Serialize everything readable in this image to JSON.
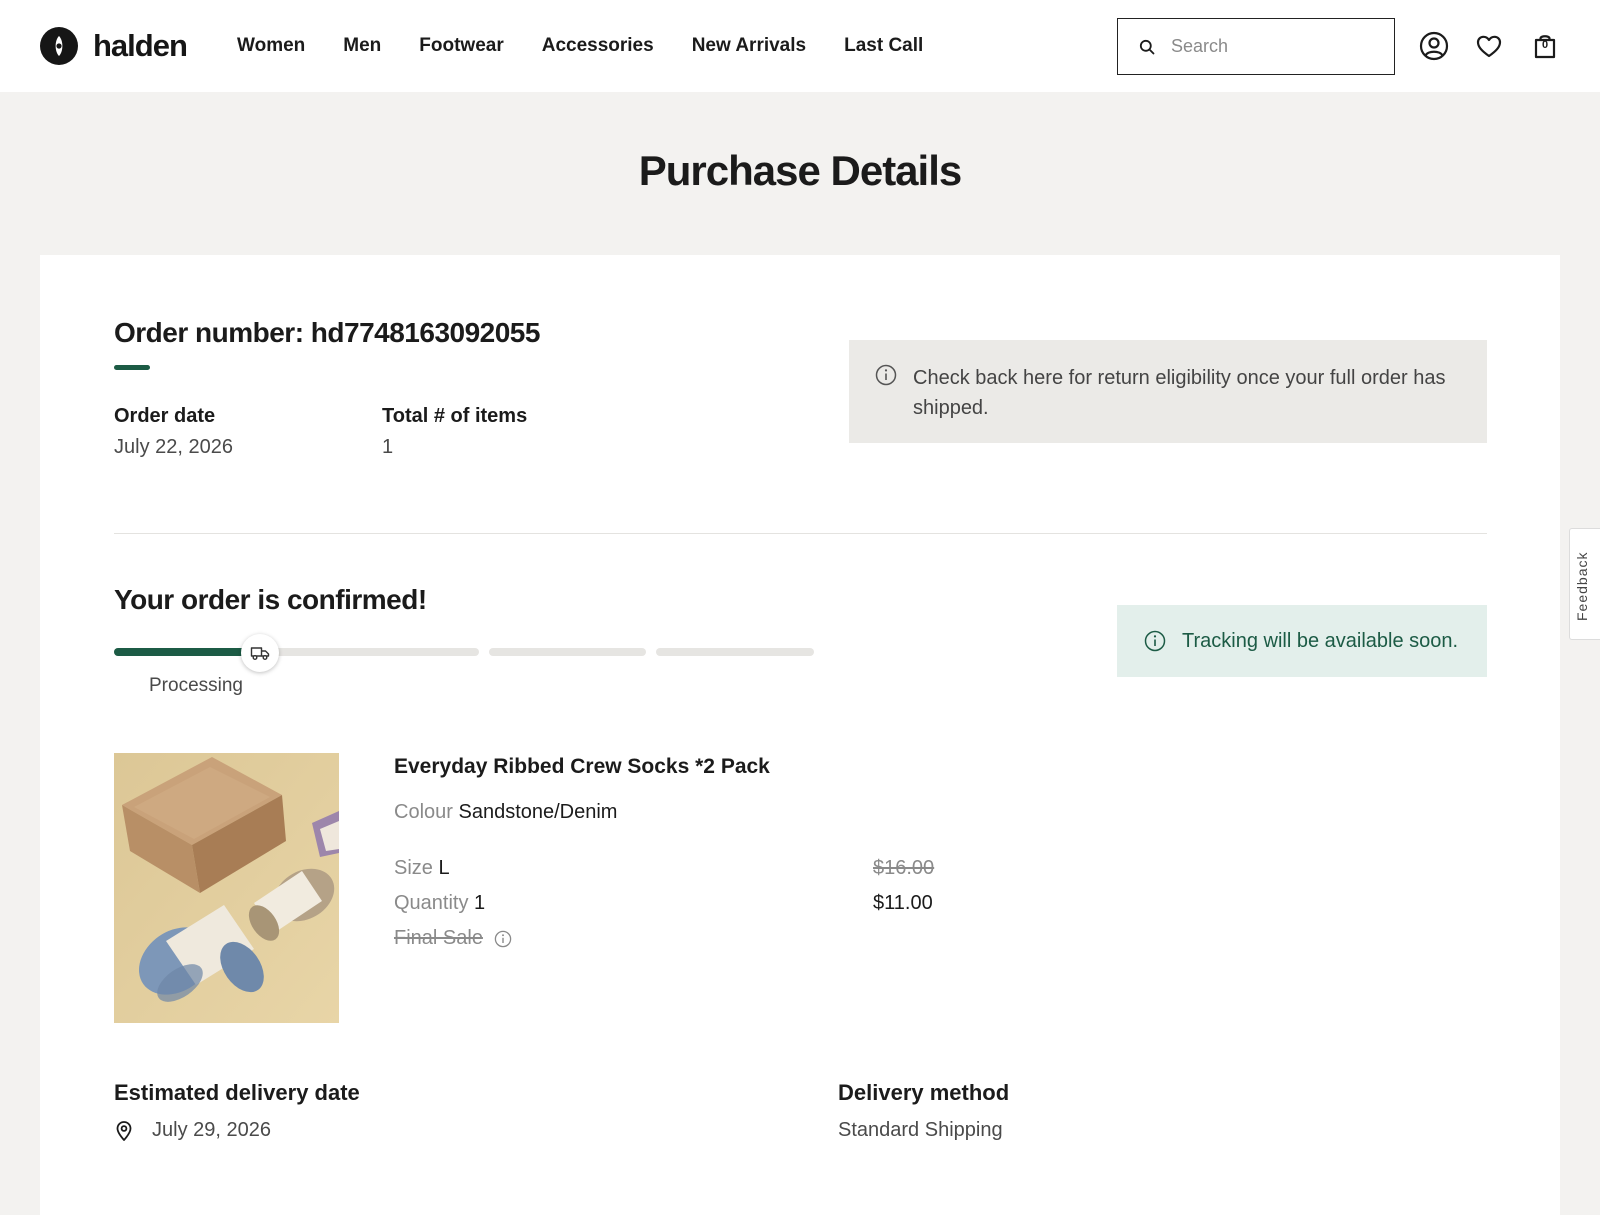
{
  "brand": {
    "name": "halden",
    "accent_color": "#1c5b45"
  },
  "nav": {
    "items": [
      "Women",
      "Men",
      "Footwear",
      "Accessories",
      "New Arrivals",
      "Last Call"
    ]
  },
  "search": {
    "placeholder": "Search",
    "value": ""
  },
  "header_icons": {
    "account": "account-icon",
    "wishlist": "heart-icon",
    "bag": "shopping-bag-icon",
    "bag_count": "0"
  },
  "page": {
    "title": "Purchase Details"
  },
  "order": {
    "number_label": "Order number: hd7748163092055",
    "date_label": "Order date",
    "date_value": "July 22, 2026",
    "items_label": "Total # of items",
    "items_value": "1",
    "return_notice": "Check back here for return eligibility once your full order has shipped."
  },
  "status": {
    "title": "Your order is confirmed!",
    "stage": "Processing",
    "progress": 0.2,
    "tracking_notice": "Tracking will be available soon."
  },
  "product": {
    "name": "Everyday Ribbed Crew Socks *2 Pack",
    "colour_label": "Colour",
    "colour_value": "Sandstone/Denim",
    "size_label": "Size",
    "size_value": "L",
    "quantity_label": "Quantity",
    "quantity_value": "1",
    "final_sale": "Final Sale",
    "price_original": "$16.00",
    "price_current": "$11.00"
  },
  "delivery": {
    "estimated_label": "Estimated delivery date",
    "estimated_value": "July 29, 2026",
    "method_label": "Delivery method",
    "method_value": "Standard Shipping"
  },
  "feedback": {
    "label": "Feedback"
  }
}
